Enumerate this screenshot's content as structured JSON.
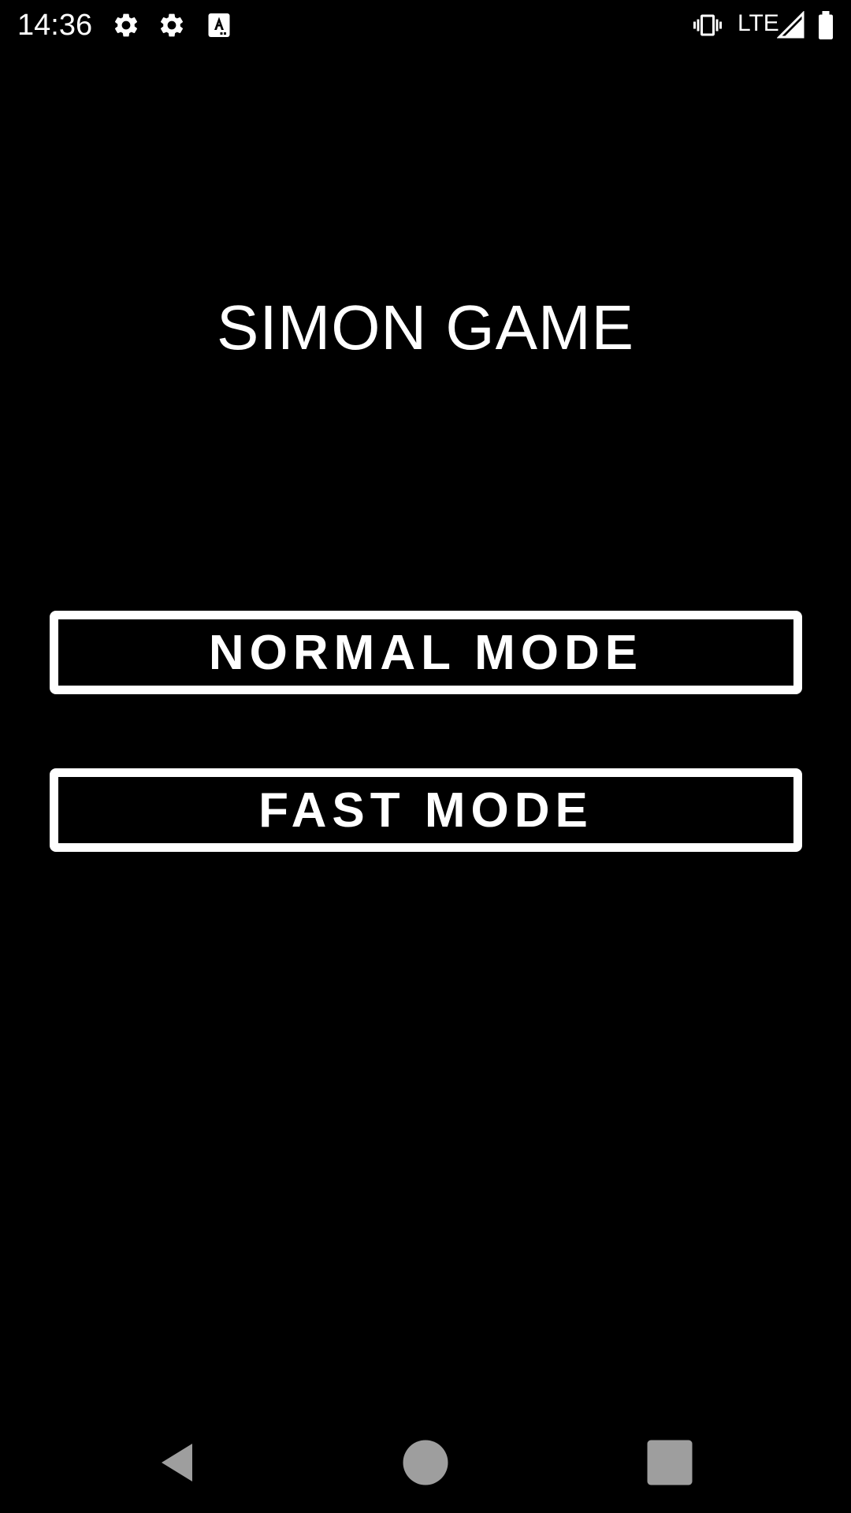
{
  "status_bar": {
    "time": "14:36",
    "network": "LTE",
    "icons": [
      "gear-icon",
      "gear-icon",
      "keyboard-a-icon",
      "vibrate-icon",
      "signal-icon",
      "battery-icon"
    ]
  },
  "app": {
    "title": "SIMON GAME"
  },
  "buttons": {
    "normal_mode": "NORMAL MODE",
    "fast_mode": "FAST MODE"
  },
  "nav_bar": {
    "icons": [
      "back-icon",
      "home-icon",
      "recents-icon"
    ]
  },
  "colors": {
    "background": "#000000",
    "foreground": "#ffffff",
    "nav_icon": "#9e9e9e"
  }
}
